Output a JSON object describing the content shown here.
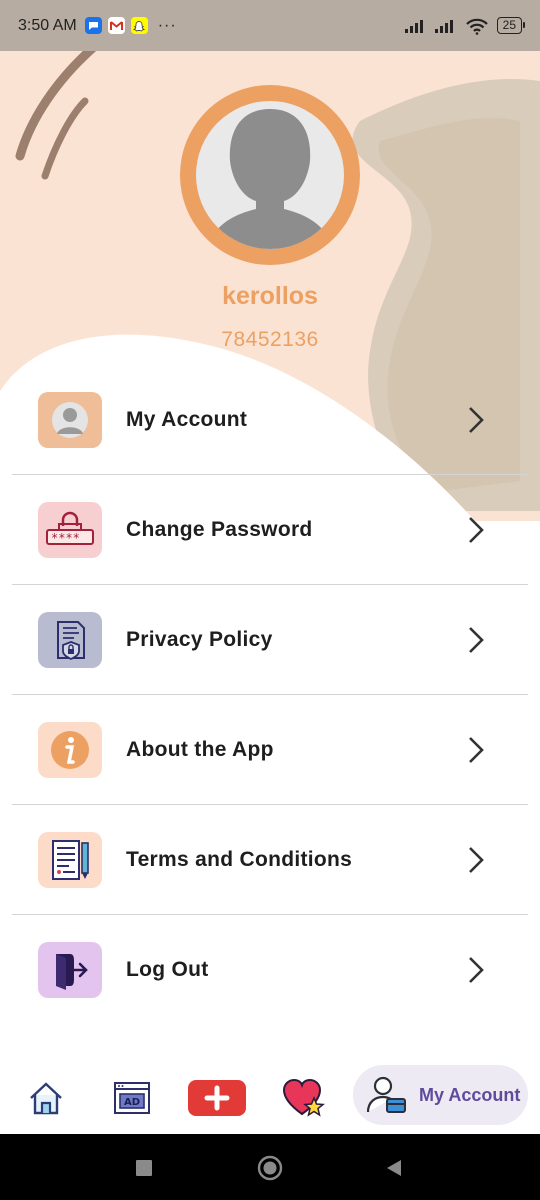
{
  "status_bar": {
    "time": "3:50 AM",
    "notifications": [
      "messages-icon",
      "gmail-icon",
      "snapchat-icon"
    ],
    "more": "···",
    "battery": "25"
  },
  "profile": {
    "name": "kerollos",
    "phone": "78452136"
  },
  "menu": {
    "items": [
      {
        "label": "My Account",
        "icon": "account-icon",
        "icon_bg": "#efbd97"
      },
      {
        "label": "Change Password",
        "icon": "password-lock-icon",
        "icon_bg": "#f8cfd0"
      },
      {
        "label": "Privacy Policy",
        "icon": "privacy-document-icon",
        "icon_bg": "#b9bcd1"
      },
      {
        "label": "About the App",
        "icon": "info-icon",
        "icon_bg": "#fcdcc8"
      },
      {
        "label": "Terms and Conditions",
        "icon": "terms-document-icon",
        "icon_bg": "#fcdcc8"
      },
      {
        "label": "Log Out",
        "icon": "logout-icon",
        "icon_bg": "#e2c4ee"
      }
    ]
  },
  "bottom_nav": {
    "items": [
      "home-icon",
      "ads-icon",
      "add-icon",
      "favorites-icon",
      "account-card-icon"
    ],
    "active_label": "My Account"
  },
  "colors": {
    "accent": "#eca062",
    "header_bg": "#fbe3d4",
    "active_nav_text": "#5f4b9c"
  }
}
